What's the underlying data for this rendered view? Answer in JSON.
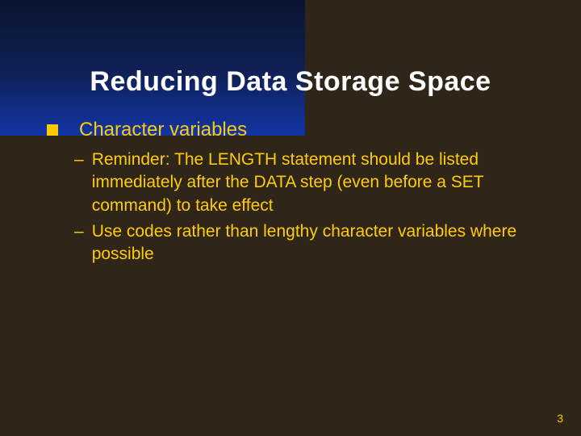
{
  "slide": {
    "title": "Reducing Data Storage Space",
    "bullet": {
      "label": "Character variables",
      "subs": [
        "Reminder: The LENGTH statement should be listed immediately after the DATA step (even before a SET command) to take effect",
        "Use codes rather than lengthy character variables where possible"
      ]
    },
    "page_number": "3",
    "dash": "–"
  }
}
